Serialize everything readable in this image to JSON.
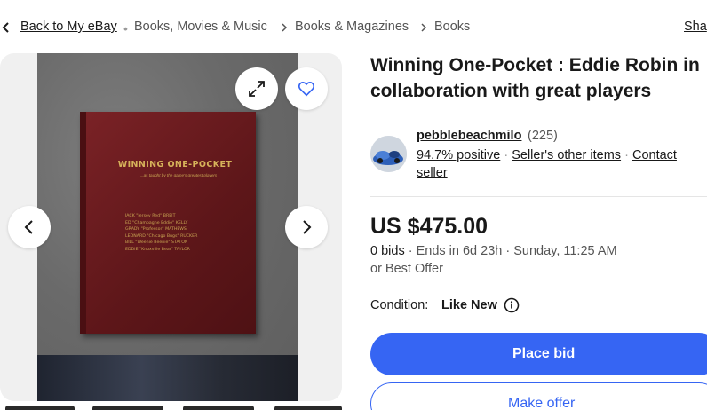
{
  "breadcrumb": {
    "back_label": "Back to My eBay",
    "items": [
      "Books, Movies & Music",
      "Books & Magazines",
      "Books"
    ],
    "share_label": "Sha"
  },
  "gallery": {
    "book": {
      "title": "WINNING ONE-POCKET",
      "subtitle": "...as taught by the game's greatest players",
      "names": [
        "JACK \"Jersey Red\" BREIT",
        "ED \"Champagne Eddie\" KELLY",
        "GRADY \"Professor\" MATHEWS",
        "LEONARD \"Chicago Bugs\" RUCKER",
        "BILL \"Weenie Beenie\" STATON",
        "EDDIE \"Knoxville Bear\" TAYLOR"
      ]
    }
  },
  "listing": {
    "title": "Winning One-Pocket : Eddie Robin in collaboration with great players",
    "seller": {
      "name": "pebblebeachmilo",
      "feedback_count": "(225)",
      "positive": "94.7% positive",
      "other_items": "Seller's other items",
      "contact_line1": "Contact",
      "contact_line2": "seller"
    },
    "price": "US $475.00",
    "bids": "0 bids",
    "ends": "Ends in 6d 23h · Sunday, 11:25 AM",
    "best_offer": "or Best Offer",
    "condition_label": "Condition:",
    "condition_value": "Like New",
    "place_bid_label": "Place bid",
    "make_offer_label": "Make offer"
  },
  "colors": {
    "accent": "#3665f3",
    "text": "#191919",
    "muted": "#555555"
  }
}
